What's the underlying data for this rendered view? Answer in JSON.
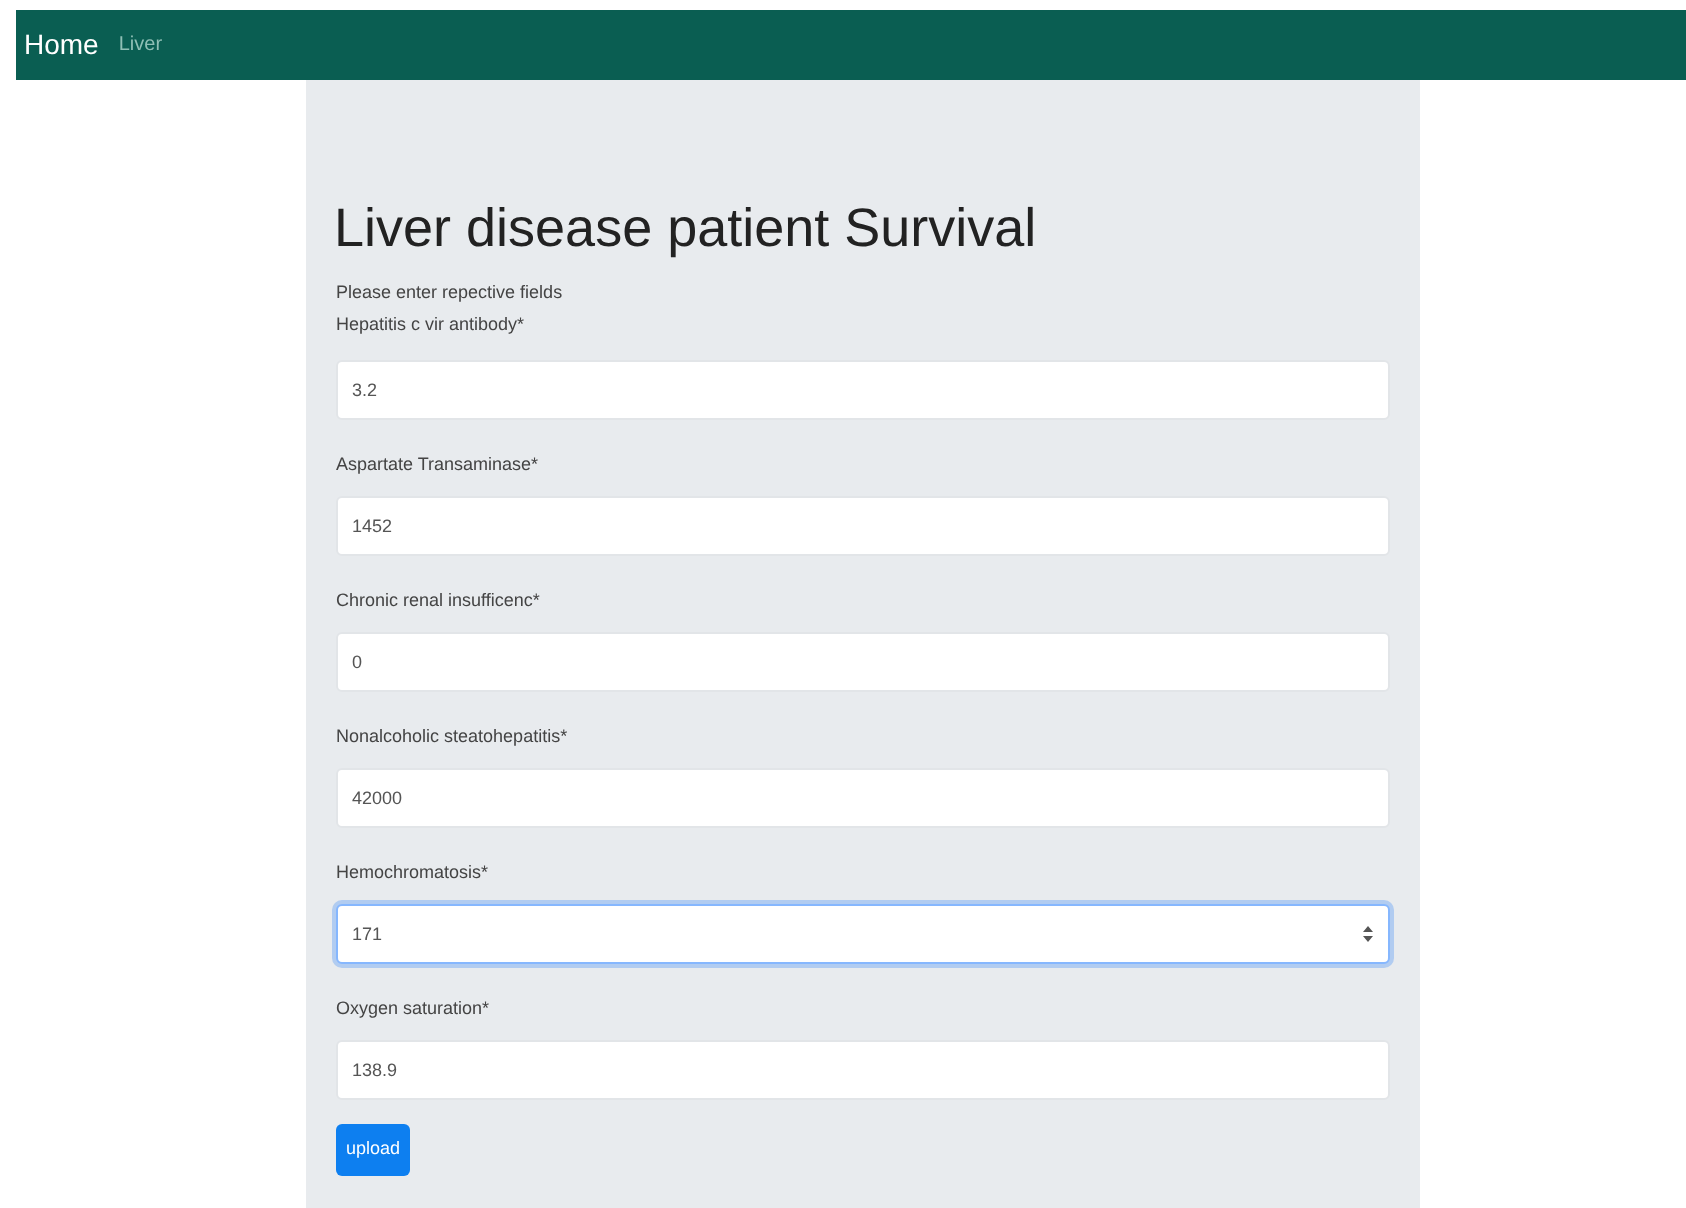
{
  "navbar": {
    "brand": "Home",
    "links": [
      {
        "label": "Liver"
      }
    ]
  },
  "title": "Liver disease patient Survival",
  "instruction": "Please enter repective fields",
  "fields": [
    {
      "label": "Hepatitis c vir antibody*",
      "value": "3.2",
      "focused": false
    },
    {
      "label": "Aspartate Transaminase*",
      "value": "1452",
      "focused": false
    },
    {
      "label": "Chronic renal insufficenc*",
      "value": "0",
      "focused": false
    },
    {
      "label": "Nonalcoholic steatohepatitis*",
      "value": "42000",
      "focused": false
    },
    {
      "label": "Hemochromatosis*",
      "value": "171",
      "focused": true
    },
    {
      "label": "Oxygen saturation*",
      "value": "138.9",
      "focused": false
    }
  ],
  "submit": {
    "label": "upload"
  }
}
